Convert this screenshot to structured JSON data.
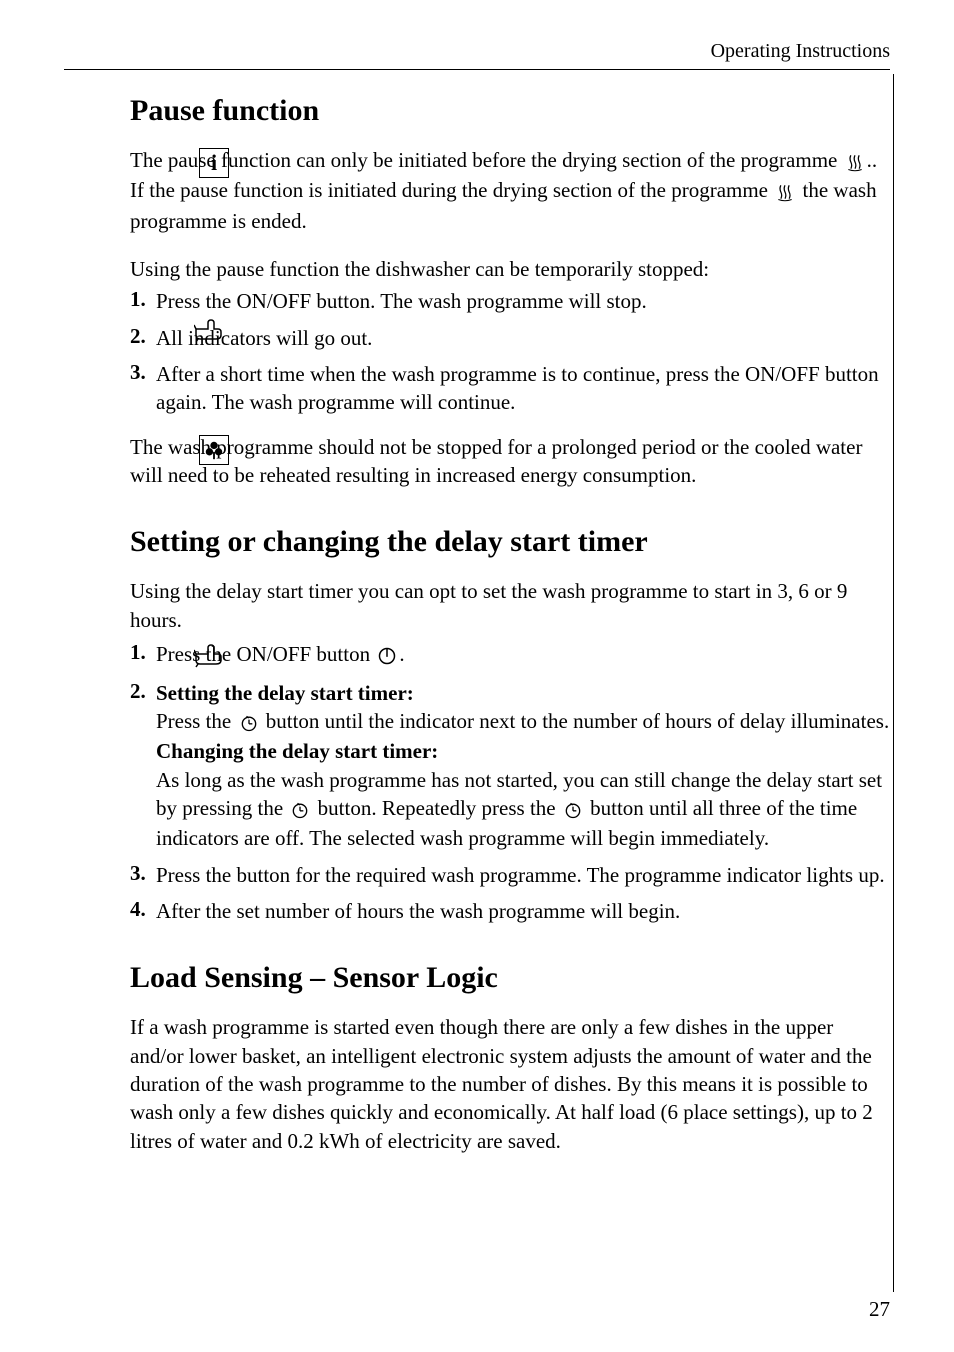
{
  "header": {
    "section_title": "Operating Instructions"
  },
  "pause_section": {
    "heading": "Pause function",
    "info_para_parts": {
      "p1": "The pause function can only be initiated before the drying section of the programme ",
      "p2": ".. If the pause function is initiated during the drying section of the programme ",
      "p3": " the wash programme is ended."
    },
    "intro": "Using the pause function the dishwasher can be temporarily stopped:",
    "steps": [
      {
        "num": "1.",
        "text": "Press the ON/OFF button. The wash programme will stop."
      },
      {
        "num": "2.",
        "text": "All indicators will go out."
      },
      {
        "num": "3.",
        "text": "After a short time when the wash programme is to continue, press the ON/OFF button again. The wash programme will continue."
      }
    ],
    "clover_note": "The wash programme should not be stopped for a prolonged period or the cooled water will need to be reheated resulting in increased energy consumption."
  },
  "delay_section": {
    "heading": "Setting or changing the delay start timer",
    "intro": "Using the delay start timer you can opt to set the wash programme to start in 3, 6 or 9 hours.",
    "steps": {
      "s1": {
        "num": "1.",
        "text_a": "Press the ON/OFF button ",
        "text_b": "."
      },
      "s2": {
        "num": "2.",
        "title": "Setting the delay start timer:",
        "para1_a": "Press the ",
        "para1_b": " button until the indicator next to the number of hours of delay illuminates.",
        "title2": "Changing the delay start timer:",
        "para2_a": "As long as the wash programme has not started, you can still change the delay start set by pressing the ",
        "para2_b": " button. Repeatedly press the ",
        "para2_c": " button until all three of the time indicators are off. The selected wash programme will begin immediately."
      },
      "s3": {
        "num": "3.",
        "text": "Press the button for the required wash programme. The programme indicator lights up."
      },
      "s4": {
        "num": "4.",
        "text": "After the set number of hours the wash programme will begin."
      }
    }
  },
  "load_section": {
    "heading": "Load Sensing – Sensor Logic",
    "para": "If a wash programme is started even though there are only a few dishes in the upper and/or lower basket, an intelligent electronic system adjusts the amount of water and the duration of the wash programme to the number of dishes. By this means it is possible to wash only a few dishes quickly and economically. At half load (6 place settings), up to 2 litres of water and 0.2 kWh of electricity are saved."
  },
  "page_number": "27"
}
